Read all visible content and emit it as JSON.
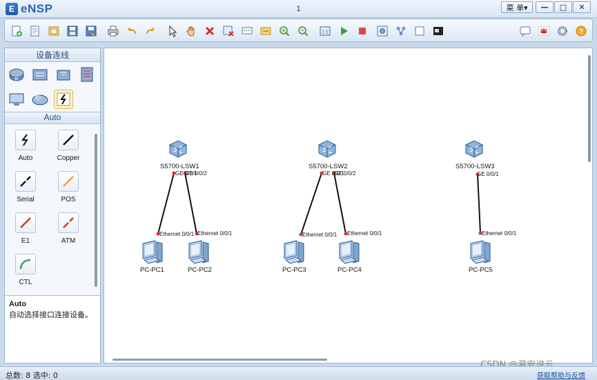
{
  "app": {
    "logo_letter": "E",
    "name": "eNSP",
    "window_title": "1",
    "menu_label": "菜 单▾"
  },
  "window_buttons": {
    "minimize": "—",
    "maximize": "□",
    "close": "✕"
  },
  "toolbar": {
    "icons": [
      "new-topology-icon",
      "new-example-icon",
      "open-icon",
      "save-icon",
      "save-as-icon",
      "print-icon",
      "undo-icon",
      "redo-icon",
      "select-cursor-icon",
      "pan-hand-icon",
      "delete-icon",
      "delete-links-icon",
      "text-icon",
      "palette-icon",
      "zoom-in-icon",
      "zoom-out-icon",
      "fit-view-icon",
      "start-device-icon",
      "stop-device-icon",
      "capture-icon",
      "topology-icon",
      "grid-icon",
      "screenshot-icon",
      "chat-icon",
      "huawei-icon",
      "settings-icon",
      "help-icon"
    ]
  },
  "left_panel": {
    "header": "设备连线",
    "categories": [
      "router-icon",
      "switch-icon",
      "wlan-icon",
      "firewall-icon",
      "pc-icon",
      "cloud-icon",
      "connection-icon"
    ],
    "sub_header": "Auto",
    "cables": [
      {
        "label": "Auto",
        "icon": "auto-cable-icon"
      },
      {
        "label": "Copper",
        "icon": "copper-cable-icon"
      },
      {
        "label": "Serial",
        "icon": "serial-cable-icon"
      },
      {
        "label": "POS",
        "icon": "pos-cable-icon"
      },
      {
        "label": "E1",
        "icon": "e1-cable-icon"
      },
      {
        "label": "ATM",
        "icon": "atm-cable-icon"
      },
      {
        "label": "CTL",
        "icon": "ctl-cable-icon"
      }
    ],
    "description": {
      "title": "Auto",
      "text": "自动选择接口连接设备。"
    }
  },
  "topology": {
    "devices": [
      {
        "id": "sw1",
        "name": "S5700-LSW1",
        "type": "switch"
      },
      {
        "id": "sw2",
        "name": "S5700-LSW2",
        "type": "switch"
      },
      {
        "id": "sw3",
        "name": "S5700-LSW3",
        "type": "switch"
      },
      {
        "id": "pc1",
        "name": "PC-PC1",
        "type": "pc"
      },
      {
        "id": "pc2",
        "name": "PC-PC2",
        "type": "pc"
      },
      {
        "id": "pc3",
        "name": "PC-PC3",
        "type": "pc"
      },
      {
        "id": "pc4",
        "name": "PC-PC4",
        "type": "pc"
      },
      {
        "id": "pc5",
        "name": "PC-PC5",
        "type": "pc"
      }
    ],
    "links": [
      {
        "from": "sw1",
        "from_port": "GE 0/0/1",
        "to": "pc1",
        "to_port": "Ethernet 0/0/1"
      },
      {
        "from": "sw1",
        "from_port": "GE 0/0/2",
        "to": "pc2",
        "to_port": "Ethernet 0/0/1"
      },
      {
        "from": "sw2",
        "from_port": "GE 0/0/1",
        "to": "pc3",
        "to_port": "Ethernet 0/0/1"
      },
      {
        "from": "sw2",
        "from_port": "GE 0/0/2",
        "to": "pc4",
        "to_port": "Ethernet 0/0/1"
      },
      {
        "from": "sw3",
        "from_port": "GE 0/0/1",
        "to": "pc5",
        "to_port": "Ethernet 0/0/1"
      }
    ]
  },
  "status": {
    "total_label": "总数: 8 选中: 0",
    "feedback_link": "获取帮助与反馈"
  },
  "watermark": "CSDN @易安说云",
  "colors": {
    "link": "#111111",
    "port_dot": "#e0302c",
    "accent": "#2a63ad"
  }
}
